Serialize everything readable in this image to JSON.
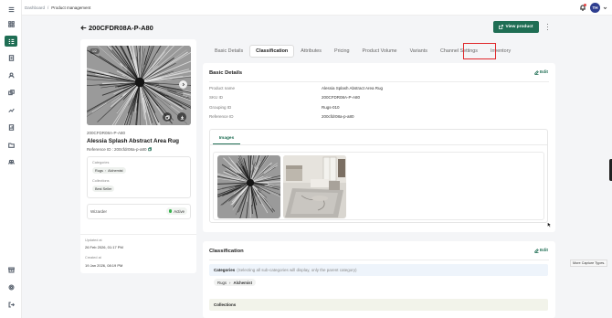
{
  "breadcrumb": {
    "home": "Dashboard",
    "separator": "/",
    "current": "Product management"
  },
  "user": {
    "initials": "TH"
  },
  "header": {
    "title": "200CFDR08A-P-A80",
    "view_product": "View product"
  },
  "nav": {
    "top_icons": [
      "dashboard-icon",
      "catalog-icon",
      "document-icon",
      "user-icon",
      "layers-icon",
      "chart-icon",
      "report-icon",
      "folder-icon",
      "users-icon"
    ],
    "bottom_icons": [
      "archive-icon",
      "settings-icon",
      "logout-icon"
    ],
    "active_index": 1
  },
  "product": {
    "image_badge": "1/2",
    "sku": "200CFDR08A-P-A80",
    "name": "Alessia Splash Abstract Area Rug",
    "reference_label": "Reference ID :",
    "reference_value": "200cfdr08a-p-a80",
    "categories_label": "Categories",
    "category_parent": "Rugs",
    "category_child": "Alchemist",
    "collections_label": "Collections",
    "collection": "Best Seller",
    "wizard_label": "Wizarder",
    "wizard_status": "Active",
    "updated_label": "Updated at",
    "updated_value": "26 Feb 2026, 01:17 PM",
    "created_label": "Created at",
    "created_value": "19 Jan 2026, 08:19 PM"
  },
  "tabs": [
    "Basic Details",
    "Classification",
    "Attributes",
    "Pricing",
    "Product Volume",
    "Variants",
    "Channel Settings",
    "Inventory"
  ],
  "active_tab": "Classification",
  "basic_details": {
    "title": "Basic Details",
    "edit": "Edit",
    "fields": [
      {
        "label": "Product name",
        "value": "Alessia Splash Abstract Area Rug"
      },
      {
        "label": "SKU ID",
        "value": "200CFDR08A-P-A80"
      },
      {
        "label": "Grouping ID",
        "value": "Rugs-010"
      },
      {
        "label": "Reference ID",
        "value": "200cfdr08a-p-a80"
      }
    ],
    "images_tab": "Images"
  },
  "classification": {
    "title": "Classification",
    "edit": "Edit",
    "categories_label": "Categories",
    "categories_hint": "(Selecting all sub-categories will display, only the parent category)",
    "category_parent": "Rugs",
    "category_child": "Alchemist",
    "collections_label": "Collections"
  },
  "tooltip": "More Capture Types.",
  "colors": {
    "brand": "#1f6e54",
    "highlight": "#e0272a"
  }
}
